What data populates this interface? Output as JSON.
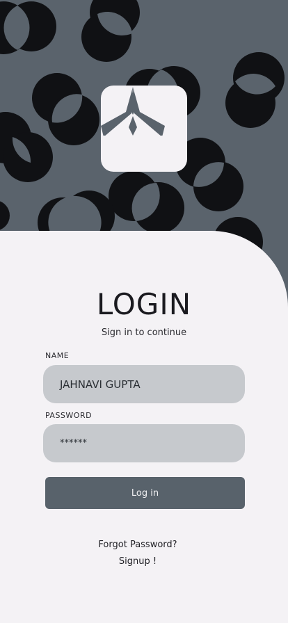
{
  "logo": {
    "icon": "paper-plane-icon"
  },
  "login": {
    "title": "LOGIN",
    "subtitle": "Sign in to continue",
    "name_label": "NAME",
    "name_value": "JAHNAVI GUPTA",
    "password_label": "PASSWORD",
    "password_value": "******",
    "button_label": "Log in",
    "forgot_label": "Forgot Password?",
    "signup_label": "Signup !"
  },
  "colors": {
    "hero_bg": "#5a636c",
    "sheet_bg": "#f4f2f5",
    "field_bg": "#c6c9cd",
    "button_bg": "#58626b",
    "circle": "#101114"
  }
}
